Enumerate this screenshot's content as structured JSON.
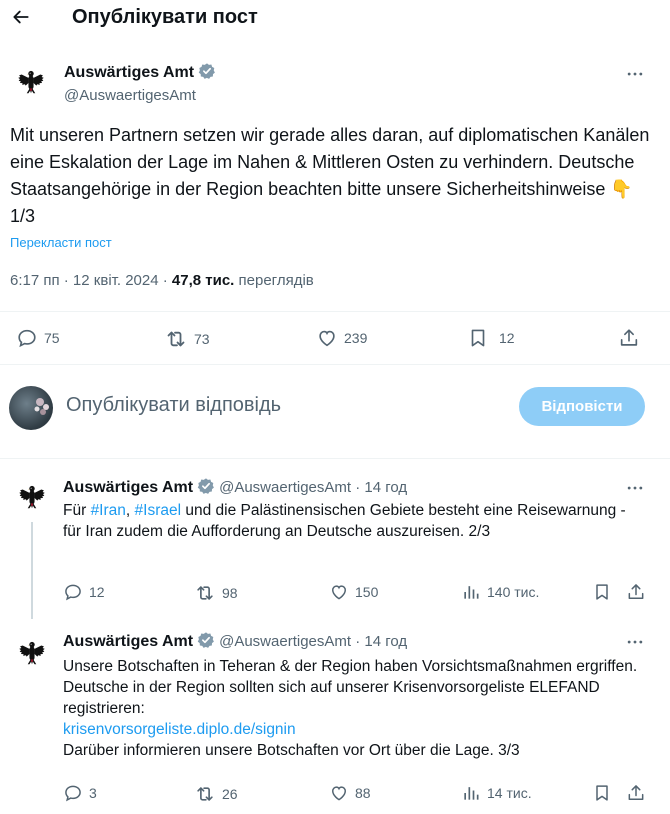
{
  "header": {
    "title": "Опублікувати пост"
  },
  "main_post": {
    "author": "Auswärtiges Amt",
    "handle": "@AuswaertigesAmt",
    "text": "Mit unseren Partnern setzen wir gerade alles daran, auf diplomatischen Kanälen eine Eskalation der Lage im Nahen & Mittleren Osten zu verhindern. Deutsche Staatsangehörige in der Region beachten bitte unsere Sicherheitshinweise 👇 1/3",
    "translate_label": "Перекласти пост",
    "timestamp": "6:17 пп · 12 квіт. 2024 · ",
    "views_count": "47,8 тис.",
    "views_label": "переглядів",
    "replies": "75",
    "reposts": "73",
    "likes": "239",
    "bookmarks": "12"
  },
  "composer": {
    "placeholder": "Опублікувати відповідь",
    "button_label": "Відповісти"
  },
  "thread": [
    {
      "author": "Auswärtiges Amt",
      "handle": "@AuswaertigesAmt",
      "time": " · 14 год",
      "text_parts": [
        "Für ",
        "#Iran",
        ", ",
        "#Israel",
        " und die Palästinensischen Gebiete besteht eine Reisewarnung - für Iran zudem die Aufforderung an Deutsche auszureisen. 2/3"
      ],
      "replies": "12",
      "reposts": "98",
      "likes": "150",
      "views": "140 тис."
    },
    {
      "author": "Auswärtiges Amt",
      "handle": "@AuswaertigesAmt",
      "time": " · 14 год",
      "text_before": "Unsere Botschaften in Teheran & der Region haben Vorsichtsmaßnahmen ergriffen. Deutsche in der Region sollten sich auf unserer Krisenvorsorgeliste ELEFAND registrieren:",
      "link": "krisenvorsorgeliste.diplo.de/signin",
      "text_after": "Darüber informieren unsere Botschaften vor Ort über die Lage. 3/3",
      "replies": "3",
      "reposts": "26",
      "likes": "88",
      "views": "14 тис."
    }
  ],
  "colors": {
    "accent": "#1d9bf0",
    "muted": "#536471",
    "button_disabled": "#8ecdf7"
  }
}
